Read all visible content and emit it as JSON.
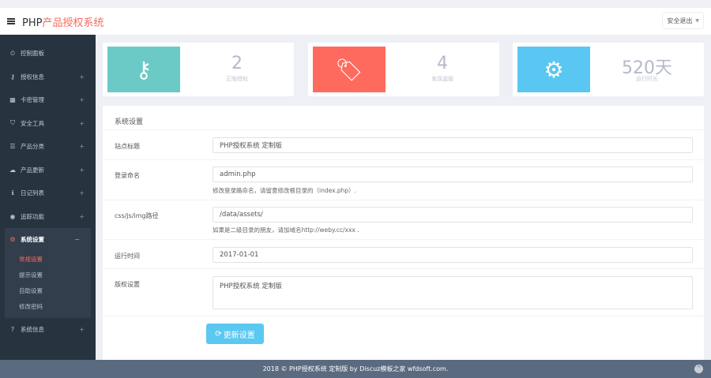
{
  "header": {
    "brand_prefix": "PHP",
    "brand_suffix": "产品授权系统",
    "logout": "安全退出"
  },
  "sidebar": {
    "items": [
      {
        "label": "控制面板",
        "icon": "⏲"
      },
      {
        "label": "授权信息",
        "icon": "⚷",
        "expand": "+"
      },
      {
        "label": "卡密管理",
        "icon": "▦",
        "expand": "+"
      },
      {
        "label": "安全工具",
        "icon": "⛉",
        "expand": "+"
      },
      {
        "label": "产品分类",
        "icon": "☰",
        "expand": "+"
      },
      {
        "label": "产品更新",
        "icon": "☁",
        "expand": "+"
      },
      {
        "label": "日记列表",
        "icon": "ℹ",
        "expand": "+"
      },
      {
        "label": "追踪功能",
        "icon": "◉",
        "expand": "+"
      }
    ],
    "active_group": {
      "label": "系统设置",
      "icon": "⚙",
      "expand": "−",
      "subs": [
        "常规设置",
        "提示设置",
        "自助设置",
        "修改密码"
      ]
    },
    "last": {
      "label": "系统信息",
      "icon": "?",
      "expand": "+"
    }
  },
  "stats": [
    {
      "value": "2",
      "label": "正版授权",
      "color": "#6ccac6",
      "icon": "⚷"
    },
    {
      "value": "4",
      "label": "发现盗版",
      "color": "#ff6a5e",
      "icon": "🏷"
    },
    {
      "value": "520天",
      "label": "运行时长",
      "color": "#59c7f2",
      "icon": "⚙"
    }
  ],
  "panel": {
    "title": "系统设置",
    "fields": [
      {
        "label": "站点标题",
        "value": "PHP授权系统 定制版"
      },
      {
        "label": "登录命名",
        "value": "admin.php",
        "help": "修改登录路命名，请留意修改根目录的（index.php）."
      },
      {
        "label": "css/js/img路径",
        "value": "/data/assets/",
        "help": "如果是二级目录的朋友，请加域名http://weby.cc/xxx ."
      },
      {
        "label": "运行时间",
        "value": "2017-01-01"
      },
      {
        "label": "版权设置",
        "value": "PHP授权系统 定制版"
      }
    ],
    "submit": "更新设置",
    "submit_icon": "⟳"
  },
  "footer": {
    "text": "2018 © PHP授权系统 定制版 by Discuz模板之家 wfdsoft.com.",
    "totop": "^"
  }
}
